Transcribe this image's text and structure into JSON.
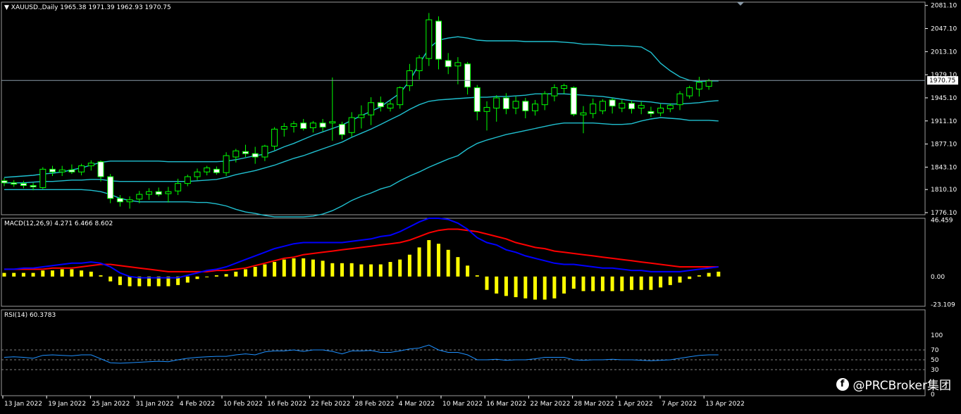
{
  "chart_data": [
    {
      "type": "candlestick",
      "header": {
        "marker": "▼",
        "symbol_tf": "XAUUSD.,Daily",
        "ohlc": "1965.38 1971.39 1962.93 1970.75"
      },
      "price_axis_ticks": [
        "2081.10",
        "2047.10",
        "2013.10",
        "1979.10",
        "1945.10",
        "1911.10",
        "1877.10",
        "1843.10",
        "1810.10",
        "1776.10"
      ],
      "tick_values": [
        2081.1,
        2047.1,
        2013.1,
        1979.1,
        1945.1,
        1911.1,
        1877.1,
        1843.1,
        1810.1,
        1776.1
      ],
      "current_price_label": "1970.75",
      "current_price": 1970.75,
      "ylim": [
        1773,
        2086
      ],
      "x_labels": [
        "13 Jan 2022",
        "19 Jan 2022",
        "25 Jan 2022",
        "31 Jan 2022",
        "4 Feb 2022",
        "10 Feb 2022",
        "16 Feb 2022",
        "22 Feb 2022",
        "28 Feb 2022",
        "4 Mar 2022",
        "10 Mar 2022",
        "16 Mar 2022",
        "22 Mar 2022",
        "28 Mar 2022",
        "1 Apr 2022",
        "7 Apr 2022",
        "13 Apr 2022"
      ],
      "candles": [
        [
          1823,
          1827,
          1815,
          1820
        ],
        [
          1820,
          1824,
          1814,
          1818
        ],
        [
          1819,
          1823,
          1812,
          1816
        ],
        [
          1816,
          1820,
          1809,
          1814
        ],
        [
          1813,
          1843,
          1811,
          1840
        ],
        [
          1840,
          1845,
          1830,
          1836
        ],
        [
          1836,
          1845,
          1830,
          1839
        ],
        [
          1839,
          1847,
          1833,
          1836
        ],
        [
          1836,
          1848,
          1831,
          1845
        ],
        [
          1845,
          1853,
          1838,
          1849
        ],
        [
          1851,
          1853,
          1822,
          1829
        ],
        [
          1829,
          1833,
          1790,
          1797
        ],
        [
          1797,
          1802,
          1785,
          1792
        ],
        [
          1792,
          1800,
          1782,
          1795
        ],
        [
          1796,
          1808,
          1790,
          1803
        ],
        [
          1803,
          1812,
          1795,
          1807
        ],
        [
          1807,
          1813,
          1800,
          1803
        ],
        [
          1804,
          1814,
          1791,
          1807
        ],
        [
          1808,
          1826,
          1802,
          1819
        ],
        [
          1819,
          1832,
          1815,
          1829
        ],
        [
          1829,
          1841,
          1824,
          1836
        ],
        [
          1836,
          1845,
          1831,
          1842
        ],
        [
          1840,
          1844,
          1832,
          1835
        ],
        [
          1835,
          1865,
          1830,
          1860
        ],
        [
          1858,
          1870,
          1850,
          1867
        ],
        [
          1866,
          1876,
          1858,
          1863
        ],
        [
          1863,
          1873,
          1848,
          1858
        ],
        [
          1858,
          1876,
          1852,
          1874
        ],
        [
          1874,
          1902,
          1868,
          1899
        ],
        [
          1899,
          1908,
          1888,
          1903
        ],
        [
          1903,
          1911,
          1894,
          1907
        ],
        [
          1908,
          1914,
          1897,
          1900
        ],
        [
          1901,
          1911,
          1894,
          1908
        ],
        [
          1908,
          1914,
          1896,
          1902
        ],
        [
          1908,
          1975,
          1882,
          1910
        ],
        [
          1906,
          1910,
          1884,
          1891
        ],
        [
          1894,
          1924,
          1888,
          1916
        ],
        [
          1916,
          1934,
          1900,
          1920
        ],
        [
          1920,
          1946,
          1905,
          1938
        ],
        [
          1938,
          1947,
          1925,
          1932
        ],
        [
          1930,
          1942,
          1925,
          1936
        ],
        [
          1935,
          1962,
          1929,
          1960
        ],
        [
          1963,
          1995,
          1955,
          1985
        ],
        [
          1985,
          2008,
          1972,
          2004
        ],
        [
          2003,
          2070,
          1992,
          2060
        ],
        [
          2058,
          2065,
          1987,
          2002
        ],
        [
          2000,
          2011,
          1980,
          1991
        ],
        [
          1992,
          2005,
          1965,
          1997
        ],
        [
          1995,
          1998,
          1950,
          1961
        ],
        [
          1960,
          1964,
          1912,
          1925
        ],
        [
          1925,
          1940,
          1897,
          1931
        ],
        [
          1930,
          1949,
          1910,
          1945
        ],
        [
          1945,
          1952,
          1921,
          1929
        ],
        [
          1930,
          1947,
          1921,
          1940
        ],
        [
          1940,
          1945,
          1915,
          1926
        ],
        [
          1926,
          1942,
          1919,
          1936
        ],
        [
          1935,
          1955,
          1927,
          1951
        ],
        [
          1948,
          1965,
          1940,
          1960
        ],
        [
          1959,
          1966,
          1951,
          1963
        ],
        [
          1960,
          1962,
          1918,
          1921
        ],
        [
          1920,
          1933,
          1893,
          1923
        ],
        [
          1922,
          1944,
          1915,
          1936
        ],
        [
          1926,
          1943,
          1921,
          1940
        ],
        [
          1942,
          1945,
          1922,
          1933
        ],
        [
          1930,
          1942,
          1924,
          1937
        ],
        [
          1937,
          1941,
          1922,
          1929
        ],
        [
          1930,
          1939,
          1921,
          1934
        ],
        [
          1925,
          1932,
          1917,
          1922
        ],
        [
          1923,
          1936,
          1918,
          1930
        ],
        [
          1929,
          1937,
          1924,
          1934
        ],
        [
          1935,
          1955,
          1927,
          1951
        ],
        [
          1948,
          1963,
          1944,
          1960
        ],
        [
          1958,
          1976,
          1947,
          1968
        ],
        [
          1962,
          1973,
          1957,
          1970
        ]
      ],
      "bb_upper": [
        1828,
        1829,
        1830,
        1831,
        1833,
        1834,
        1836,
        1839,
        1842,
        1846,
        1850,
        1852,
        1852,
        1852,
        1852,
        1852,
        1852,
        1851,
        1851,
        1851,
        1851,
        1851,
        1851,
        1852,
        1854,
        1857,
        1860,
        1862,
        1867,
        1873,
        1878,
        1884,
        1890,
        1895,
        1900,
        1905,
        1912,
        1919,
        1925,
        1932,
        1942,
        1952,
        1970,
        1995,
        2018,
        2030,
        2033,
        2035,
        2033,
        2030,
        2029,
        2029,
        2029,
        2029,
        2028,
        2028,
        2028,
        2028,
        2027,
        2026,
        2024,
        2024,
        2023,
        2022,
        2022,
        2021,
        2020,
        2012,
        1996,
        1985,
        1976,
        1971,
        1969,
        1970,
        1970
      ],
      "bb_middle": [
        1820,
        1820,
        1820,
        1821,
        1822,
        1822,
        1823,
        1824,
        1824,
        1825,
        1825,
        1823,
        1822,
        1822,
        1822,
        1822,
        1822,
        1822,
        1822,
        1822,
        1823,
        1824,
        1825,
        1828,
        1832,
        1835,
        1838,
        1842,
        1846,
        1851,
        1856,
        1860,
        1865,
        1870,
        1875,
        1880,
        1887,
        1893,
        1899,
        1906,
        1913,
        1920,
        1928,
        1935,
        1940,
        1942,
        1943,
        1944,
        1945,
        1946,
        1946,
        1947,
        1947,
        1948,
        1949,
        1951,
        1951,
        1951,
        1951,
        1950,
        1949,
        1948,
        1947,
        1945,
        1943,
        1941,
        1940,
        1939,
        1937,
        1936,
        1936,
        1937,
        1938,
        1940,
        1941
      ],
      "bb_lower": [
        1810,
        1810,
        1810,
        1810,
        1810,
        1810,
        1810,
        1810,
        1810,
        1809,
        1807,
        1803,
        1797,
        1794,
        1792,
        1792,
        1792,
        1792,
        1792,
        1792,
        1791,
        1791,
        1789,
        1786,
        1781,
        1777,
        1775,
        1772,
        1770,
        1770,
        1770,
        1770,
        1771,
        1774,
        1779,
        1786,
        1794,
        1800,
        1805,
        1811,
        1815,
        1823,
        1830,
        1836,
        1843,
        1849,
        1855,
        1860,
        1870,
        1878,
        1883,
        1887,
        1891,
        1894,
        1897,
        1900,
        1903,
        1906,
        1908,
        1908,
        1908,
        1908,
        1907,
        1906,
        1906,
        1907,
        1911,
        1914,
        1916,
        1915,
        1914,
        1912,
        1912,
        1912,
        1911
      ]
    },
    {
      "type": "macd",
      "label": "MACD(12,26,9) 4.271 6.466 8.602",
      "axis_ticks": [
        "46.459",
        "0.00",
        "-23.109"
      ],
      "tick_values": [
        46.459,
        0,
        -23.109
      ],
      "ylim": [
        -24.5,
        48
      ],
      "histogram": [
        3,
        3,
        3,
        3,
        5,
        5,
        6,
        6,
        5,
        4,
        1,
        -4,
        -7,
        -8,
        -8,
        -8,
        -8,
        -8,
        -7,
        -5,
        -2,
        0,
        1,
        2,
        4,
        6,
        8,
        10,
        12,
        14,
        15,
        15,
        14,
        13,
        11,
        11,
        11,
        10,
        10,
        10,
        12,
        14,
        18,
        24,
        30,
        27,
        22,
        16,
        9,
        1,
        -11,
        -14,
        -16,
        -17,
        -18,
        -19,
        -19,
        -18,
        -14,
        -10,
        -12,
        -12,
        -12,
        -12,
        -12,
        -11,
        -11,
        -11,
        -9,
        -7,
        -5,
        -2,
        1,
        3,
        4
      ],
      "macd_line": [
        6,
        6,
        7,
        7,
        8,
        9,
        10,
        11,
        11,
        12,
        11,
        8,
        3,
        0,
        -1,
        -1,
        -1,
        -1,
        -1,
        1,
        3,
        5,
        6,
        8,
        11,
        14,
        17,
        20,
        23,
        25,
        27,
        28,
        28,
        28,
        28,
        28,
        29,
        30,
        31,
        33,
        34,
        37,
        41,
        45,
        48,
        48,
        47,
        44,
        39,
        32,
        28,
        26,
        22,
        20,
        17,
        15,
        13,
        11,
        10,
        10,
        9,
        8,
        7,
        7,
        6,
        5,
        5,
        4,
        4,
        4,
        4,
        5,
        6,
        7,
        8
      ],
      "signal_line": [
        6,
        6,
        6,
        6,
        6,
        7,
        7,
        7,
        8,
        9,
        10,
        10,
        9,
        8,
        7,
        6,
        5,
        4,
        4,
        4,
        4,
        4,
        5,
        5,
        6,
        7,
        9,
        11,
        13,
        15,
        16,
        18,
        19,
        20,
        21,
        22,
        23,
        24,
        25,
        26,
        27,
        28,
        30,
        33,
        36,
        38,
        39,
        39,
        38,
        37,
        35,
        33,
        31,
        28,
        26,
        24,
        23,
        21,
        20,
        19,
        18,
        17,
        16,
        15,
        14,
        13,
        12,
        11,
        10,
        9,
        8,
        8,
        8,
        8,
        8
      ]
    },
    {
      "type": "rsi",
      "label": "RSI(14) 60.3783",
      "axis_ticks": [
        "100",
        "70",
        "50",
        "30",
        "0"
      ],
      "tick_values": [
        100,
        70,
        50,
        30,
        0
      ],
      "ylim": [
        0,
        100
      ],
      "levels": [
        70,
        50,
        30
      ],
      "values": [
        55,
        56,
        55,
        53,
        59,
        60,
        59,
        58,
        60,
        60,
        52,
        44,
        43,
        44,
        45,
        46,
        47,
        46,
        50,
        53,
        55,
        56,
        57,
        57,
        60,
        62,
        60,
        66,
        68,
        68,
        70,
        67,
        70,
        70,
        67,
        62,
        68,
        68,
        69,
        65,
        65,
        68,
        72,
        74,
        80,
        70,
        65,
        65,
        60,
        50,
        50,
        51,
        49,
        50,
        50,
        52,
        55,
        55,
        55,
        50,
        49,
        50,
        50,
        51,
        50,
        50,
        49,
        48,
        49,
        50,
        53,
        56,
        59,
        60,
        60
      ]
    }
  ],
  "watermark": {
    "icon": "facebook-icon",
    "icon_glyph": "f",
    "text": "@PRCBroker集团"
  },
  "colors": {
    "background": "#000000",
    "bull_candle": "#000000",
    "bear_candle": "#ffffff",
    "wick": "#00ff00",
    "bollinger": "#20c0d0",
    "macd_hist": "#ffff00",
    "macd_line": "#0000ff",
    "signal_line": "#ff0000",
    "rsi_line": "#1e90ff",
    "grid": "#808080"
  }
}
